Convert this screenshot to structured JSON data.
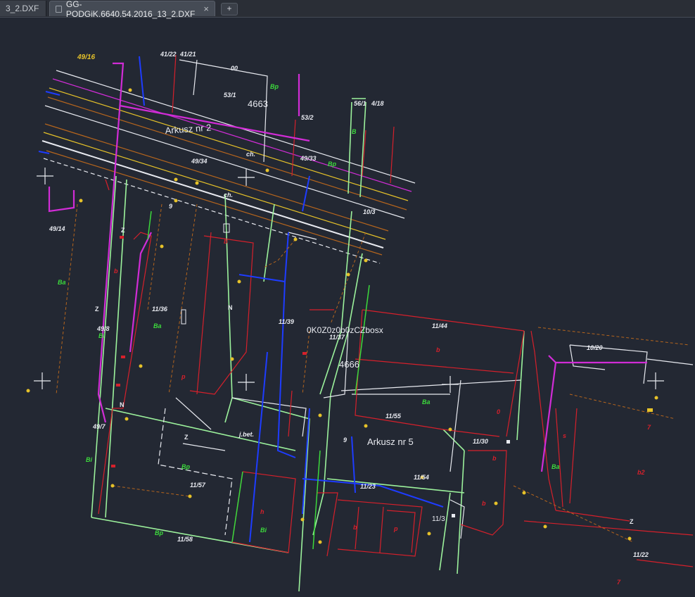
{
  "tabs": {
    "inactive_label": "3_2.DXF",
    "active_label": "GG-PODGiK.6640.54.2016_13_2.DXF",
    "new_tab_icon": "plus-icon",
    "close_icon": "close-icon"
  },
  "colors": {
    "background": "#232833",
    "white": "#e8eaf0",
    "red": "#d6202b",
    "magenta": "#d12cd6",
    "green": "#3cd93c",
    "lightgreen": "#9cf29c",
    "blue": "#1e3cff",
    "brown": "#b5651d",
    "yellow": "#e6c229"
  },
  "drawing": {
    "sheet_labels": [
      "Arkusz nr 2",
      "Arkusz nr 5"
    ],
    "block_numbers": [
      "4663",
      "4666"
    ],
    "overlap_text": "0K0Z0z0b0zCZbosx",
    "parcels": [
      "49/16",
      "41/22",
      "41/21",
      "53/1",
      "53/2",
      "56/1",
      "4/18",
      "49/33",
      "49/34",
      "10/3",
      "49/14",
      "11/36",
      "11/39",
      "49/8",
      "11/37",
      "11/44",
      "11/55",
      "11/30",
      "11/57",
      "11/54",
      "11/23",
      "11/58",
      "11/3",
      "11/22",
      "10/20",
      "49/7"
    ],
    "land_use_green": [
      "Bp",
      "B",
      "Bp",
      "Ba",
      "Bi",
      "Ba",
      "Bi",
      "Bp",
      "Ba",
      "Bp",
      "Bi",
      "Ba"
    ],
    "land_use_red": [
      "b",
      "p",
      "b",
      "b",
      "b",
      "h",
      "b",
      "p",
      "b",
      "b2",
      "7",
      "7",
      "s"
    ],
    "small_marks": [
      "00",
      "Z",
      "Z",
      "N",
      "N",
      "Z",
      "Z",
      "ch.",
      "ch.",
      "j.bet.",
      "9",
      "9",
      "0"
    ]
  }
}
